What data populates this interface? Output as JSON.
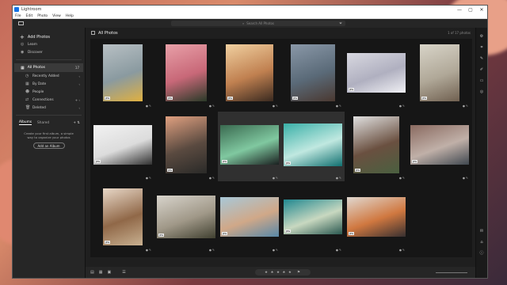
{
  "window": {
    "app_title": "Lightroom",
    "controls": [
      "—",
      "▢",
      "✕"
    ]
  },
  "menu": [
    "File",
    "Edit",
    "Photo",
    "View",
    "Help"
  ],
  "search": {
    "placeholder": "Search All Photos"
  },
  "sidebar": {
    "add_photos": "Add Photos",
    "nav": [
      {
        "label": "Learn",
        "icon": "lightbulb-icon",
        "glyph": "◎"
      },
      {
        "label": "Discover",
        "icon": "compass-icon",
        "glyph": "◉"
      }
    ],
    "all_photos": {
      "label": "All Photos",
      "count": "17"
    },
    "sub_items": [
      {
        "label": "Recently Added",
        "icon": "clock-icon",
        "glyph": "◷"
      },
      {
        "label": "By Date",
        "icon": "calendar-icon",
        "glyph": "▦"
      },
      {
        "label": "People",
        "icon": "people-icon",
        "glyph": "☻"
      },
      {
        "label": "Connections",
        "icon": "connections-icon",
        "glyph": "⇄"
      },
      {
        "label": "Deleted",
        "icon": "trash-icon",
        "glyph": "🗑"
      }
    ],
    "tabs": {
      "albums": "Albums",
      "shared": "Shared"
    },
    "albums_message": "Create your first album, a simple way to organize your photos",
    "add_album": "Add an Album"
  },
  "main": {
    "title": "All Photos",
    "count_text": "1 of 17 photos"
  },
  "photos": [
    {
      "name": "wall-photo",
      "colors": [
        "#b8c0c4",
        "#8a9aa0",
        "#e0b040"
      ],
      "badge": "JPG"
    },
    {
      "name": "roses-photo",
      "colors": [
        "#e8a0a8",
        "#c86878",
        "#2a3a28"
      ],
      "badge": "JPG"
    },
    {
      "name": "mountain-sunset-photo",
      "colors": [
        "#f0d0a0",
        "#c08050",
        "#3a2a20"
      ],
      "badge": "JPG"
    },
    {
      "name": "monkey-photo",
      "colors": [
        "#8a98a8",
        "#5a6a78",
        "#4a3830"
      ],
      "badge": "JPG"
    },
    {
      "name": "airplane-photo",
      "colors": [
        "#d8d8e0",
        "#b0b0c0",
        "#f0f0f4"
      ],
      "badge": "JPG"
    },
    {
      "name": "beach-person-photo",
      "colors": [
        "#d8d4c8",
        "#b0a898",
        "#706050"
      ],
      "badge": "JPG"
    },
    {
      "name": "polaroids-photo",
      "colors": [
        "#f2f2f2",
        "#dcdcdc",
        "#303030"
      ],
      "badge": "JPG"
    },
    {
      "name": "cliff-sunset-photo",
      "colors": [
        "#e0a080",
        "#5a4a40",
        "#2a2a28"
      ],
      "badge": "JPG"
    },
    {
      "name": "aurora-road-photo",
      "colors": [
        "#3a6a50",
        "#80c8a0",
        "#1a2020"
      ],
      "badge": "JPG"
    },
    {
      "name": "ocean-aerial-photo",
      "colors": [
        "#3ab0a8",
        "#c0e8e0",
        "#107070"
      ],
      "badge": "JPG"
    },
    {
      "name": "cow-photo",
      "colors": [
        "#e0e0e0",
        "#6a5040",
        "#4a6040"
      ],
      "badge": "JPG"
    },
    {
      "name": "laptop-desk-photo",
      "colors": [
        "#8a6a60",
        "#c0b0a8",
        "#404850"
      ],
      "badge": "JPG"
    },
    {
      "name": "rock-desert-photo",
      "colors": [
        "#e8d8c8",
        "#906848",
        "#c8b090"
      ],
      "badge": "JPG"
    },
    {
      "name": "man-laptop-photo",
      "colors": [
        "#d8d4cc",
        "#a09888",
        "#404030"
      ],
      "badge": "JPG"
    },
    {
      "name": "map-hands-photo",
      "colors": [
        "#a8c8d8",
        "#d0a888",
        "#5888a8"
      ],
      "badge": "JPG"
    },
    {
      "name": "coast-aerial-photo",
      "colors": [
        "#208890",
        "#c8d8c0",
        "#2a5850"
      ],
      "badge": "JPG"
    },
    {
      "name": "woman-camera-photo",
      "colors": [
        "#e0d8d0",
        "#d07840",
        "#383030"
      ],
      "badge": "JPG"
    }
  ],
  "bottombar": {
    "view_icons": [
      "▤",
      "▦",
      "▣"
    ],
    "sort_icon": "☰",
    "stars": "★ ★ ★ ★ ★",
    "flag": "⚑"
  },
  "rightbar": {
    "icons": [
      "settings-icon",
      "crop-icon",
      "heal-icon",
      "brush-icon",
      "gradient-icon",
      "radial-icon",
      "comment-icon",
      "tag-icon",
      "info-icon"
    ],
    "glyphs": [
      "⚙",
      "⌗",
      "✎",
      "✐",
      "▭",
      "◎",
      "✉",
      "⌂",
      "ⓘ"
    ]
  }
}
